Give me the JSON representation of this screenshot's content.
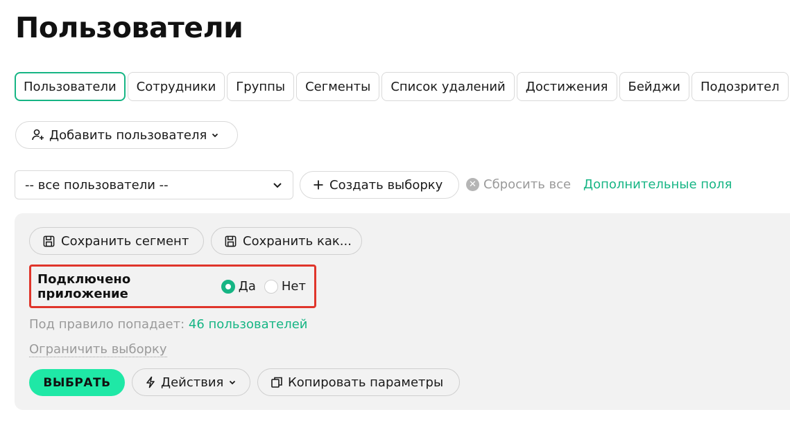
{
  "page": {
    "title": "Пользователи"
  },
  "tabs": [
    {
      "label": "Пользователи",
      "active": true
    },
    {
      "label": "Сотрудники",
      "active": false
    },
    {
      "label": "Группы",
      "active": false
    },
    {
      "label": "Сегменты",
      "active": false
    },
    {
      "label": "Список удалений",
      "active": false
    },
    {
      "label": "Достижения",
      "active": false
    },
    {
      "label": "Бейджи",
      "active": false
    },
    {
      "label": "Подозрител",
      "active": false
    }
  ],
  "toolbar": {
    "add_user_label": "Добавить пользователя",
    "add_user_icon": "user-plus-icon"
  },
  "filters": {
    "selection_value": "-- все пользователи --",
    "create_selection_label": "Создать выборку",
    "reset_all_label": "Сбросить все",
    "extra_fields_label": "Дополнительные поля"
  },
  "panel": {
    "save_segment_label": "Сохранить сегмент",
    "save_as_label": "Сохранить как...",
    "condition": {
      "label": "Подключено приложение",
      "options": [
        {
          "label": "Да",
          "checked": true
        },
        {
          "label": "Нет",
          "checked": false
        }
      ]
    },
    "rule_count_prefix": "Под правило попадает:",
    "rule_count_link": "46 пользователей",
    "limit_label": "Ограничить выборку",
    "choose_label": "ВЫБРАТЬ",
    "actions_label": "Действия",
    "copy_params_label": "Копировать параметры"
  },
  "colors": {
    "accent": "#16b584",
    "primary_button": "#1fe8a6",
    "highlight_border": "#e0352b",
    "panel_bg": "#f2f2f2"
  }
}
